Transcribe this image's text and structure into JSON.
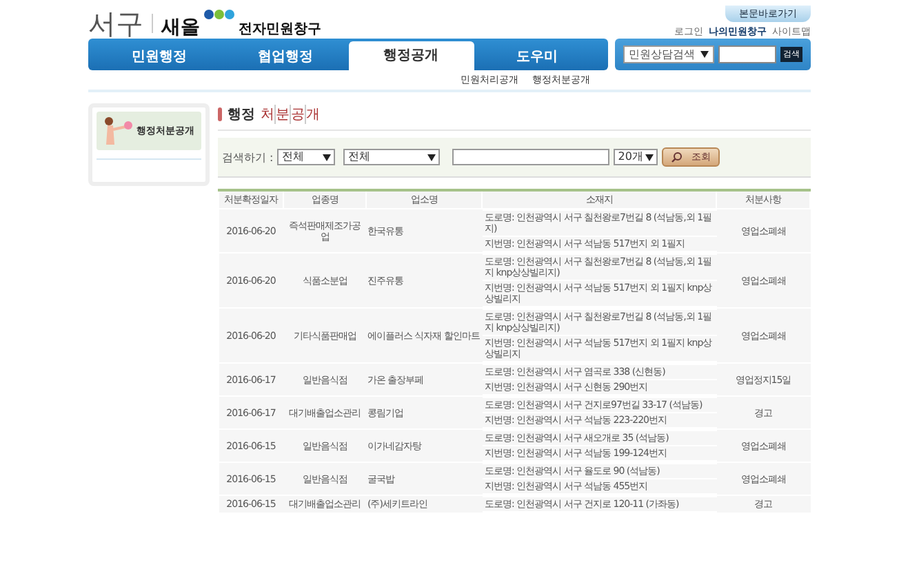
{
  "header": {
    "district": "서구",
    "brand": "새올",
    "service": "전자민원창구",
    "skip_link": "본문바로가기",
    "links": [
      {
        "label": "로그인",
        "emphasis": false
      },
      {
        "label": "나의민원창구",
        "emphasis": true
      },
      {
        "label": "사이트맵",
        "emphasis": false
      }
    ]
  },
  "nav": {
    "tabs": [
      {
        "label": "민원행정",
        "selected": false
      },
      {
        "label": "협업행정",
        "selected": false
      },
      {
        "label": "행정공개",
        "selected": true
      },
      {
        "label": "도우미",
        "selected": false
      }
    ],
    "search": {
      "category": "민원상담검색",
      "button": "검색"
    }
  },
  "submenu": [
    "민원처리공개",
    "행정처분공개"
  ],
  "sidebar": {
    "title": "행정처분공개"
  },
  "page_title": {
    "prefix": "행정",
    "accent": [
      "처",
      "분",
      "공",
      "개"
    ]
  },
  "filter": {
    "label": "검색하기 :",
    "select_1": "전체",
    "select_2": "전체",
    "page_size": "20개",
    "button": "조회"
  },
  "table": {
    "columns": [
      "처분확정일자",
      "업종명",
      "업소명",
      "소재지",
      "처분사항"
    ],
    "rows": [
      {
        "date": "2016-06-20",
        "industry": "즉석판매제조가공업",
        "business": "한국유통",
        "road": "도로명: 인천광역시 서구 칠천왕로7번길 8 (석남동,외 1필지)",
        "lot": "지번명: 인천광역시 서구 석남동 517번지 외 1필지",
        "action": "영업소폐쇄"
      },
      {
        "date": "2016-06-20",
        "industry": "식품소분업",
        "business": "진주유통",
        "road": "도로명: 인천광역시 서구 칠천왕로7번길 8 (석남동,외 1필지 knp상상빌리지)",
        "lot": "지번명: 인천광역시 서구 석남동 517번지 외 1필지 knp상상빌리지",
        "action": "영업소폐쇄"
      },
      {
        "date": "2016-06-20",
        "industry": "기타식품판매업",
        "business": "에이플러스 식자재 할인마트",
        "road": "도로명: 인천광역시 서구 칠천왕로7번길 8 (석남동,외 1필지 knp상상빌리지)",
        "lot": "지번명: 인천광역시 서구 석남동 517번지 외 1필지 knp상상빌리지",
        "action": "영업소폐쇄"
      },
      {
        "date": "2016-06-17",
        "industry": "일반음식점",
        "business": "가온 출장부페",
        "road": "도로명: 인천광역시 서구 염곡로 338 (신현동)",
        "lot": "지번명: 인천광역시 서구 신현동 290번지",
        "action": "영업정지15일"
      },
      {
        "date": "2016-06-17",
        "industry": "대기배출업소관리",
        "business": "콩림기업",
        "road": "도로명: 인천광역시 서구 건지로97번길 33-17 (석남동)",
        "lot": "지번명: 인천광역시 서구 석남동 223-220번지",
        "action": "경고"
      },
      {
        "date": "2016-06-15",
        "industry": "일반음식점",
        "business": "이가네감자탕",
        "road": "도로명: 인천광역시 서구 새오개로 35 (석남동)",
        "lot": "지번명: 인천광역시 서구 석남동 199-124번지",
        "action": "영업소폐쇄"
      },
      {
        "date": "2016-06-15",
        "industry": "일반음식점",
        "business": "굴국밥",
        "road": "도로명: 인천광역시 서구 율도로 90 (석남동)",
        "lot": "지번명: 인천광역시 서구 석남동 455번지",
        "action": "영업소폐쇄"
      },
      {
        "date": "2016-06-15",
        "industry": "대기배출업소관리",
        "business": "(주)세키트라인",
        "road": "도로명: 인천광역시 서구 건지로 120-11 (가좌동)",
        "action": "경고"
      }
    ]
  }
}
